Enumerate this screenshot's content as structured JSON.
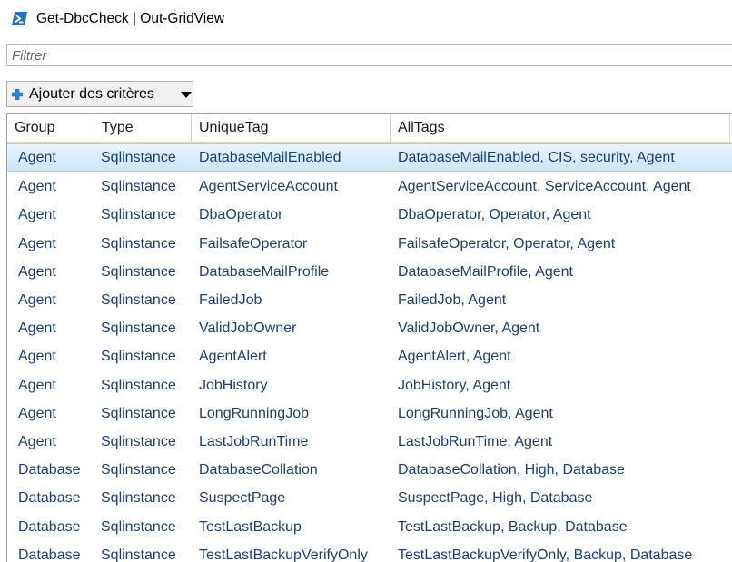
{
  "window": {
    "title": "Get-DbcCheck | Out-GridView",
    "icon": "powershell-icon"
  },
  "filter": {
    "placeholder": "Filtrer",
    "value": ""
  },
  "criteria_button": {
    "label": "Ajouter des critères",
    "icon": "plus-icon",
    "dropdown_icon": "caret-down-icon"
  },
  "grid": {
    "columns": [
      "Group",
      "Type",
      "UniqueTag",
      "AllTags"
    ],
    "selected_row": 0,
    "rows": [
      [
        "Agent",
        "Sqlinstance",
        "DatabaseMailEnabled",
        "DatabaseMailEnabled, CIS, security, Agent"
      ],
      [
        "Agent",
        "Sqlinstance",
        "AgentServiceAccount",
        "AgentServiceAccount, ServiceAccount, Agent"
      ],
      [
        "Agent",
        "Sqlinstance",
        "DbaOperator",
        "DbaOperator, Operator, Agent"
      ],
      [
        "Agent",
        "Sqlinstance",
        "FailsafeOperator",
        "FailsafeOperator, Operator, Agent"
      ],
      [
        "Agent",
        "Sqlinstance",
        "DatabaseMailProfile",
        "DatabaseMailProfile, Agent"
      ],
      [
        "Agent",
        "Sqlinstance",
        "FailedJob",
        "FailedJob, Agent"
      ],
      [
        "Agent",
        "Sqlinstance",
        "ValidJobOwner",
        "ValidJobOwner, Agent"
      ],
      [
        "Agent",
        "Sqlinstance",
        "AgentAlert",
        "AgentAlert, Agent"
      ],
      [
        "Agent",
        "Sqlinstance",
        "JobHistory",
        "JobHistory, Agent"
      ],
      [
        "Agent",
        "Sqlinstance",
        "LongRunningJob",
        "LongRunningJob, Agent"
      ],
      [
        "Agent",
        "Sqlinstance",
        "LastJobRunTime",
        "LastJobRunTime, Agent"
      ],
      [
        "Database",
        "Sqlinstance",
        "DatabaseCollation",
        "DatabaseCollation, High, Database"
      ],
      [
        "Database",
        "Sqlinstance",
        "SuspectPage",
        "SuspectPage, High, Database"
      ],
      [
        "Database",
        "Sqlinstance",
        "TestLastBackup",
        "TestLastBackup, Backup, Database"
      ],
      [
        "Database",
        "Sqlinstance",
        "TestLastBackupVerifyOnly",
        "TestLastBackupVerifyOnly, Backup, Database"
      ]
    ]
  },
  "colors": {
    "cell_text": "#1c3f75",
    "selection": "#cce7fb",
    "selection_border": "#99d1f8",
    "powershell_blue": "#2671be"
  }
}
